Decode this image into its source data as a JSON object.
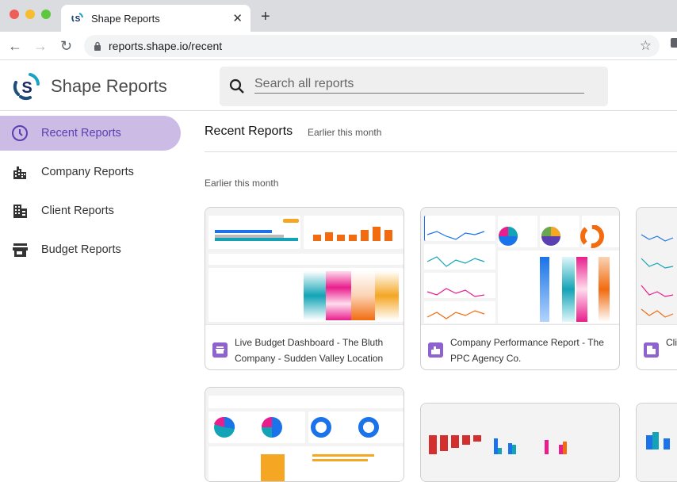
{
  "browser": {
    "tab_title": "Shape Reports",
    "tab_close": "✕",
    "new_tab": "+",
    "url": "reports.shape.io/recent",
    "back": "←",
    "forward": "→",
    "reload": "↻",
    "bookmark": "☆"
  },
  "app": {
    "brand": "Shape Reports",
    "search_placeholder": "Search all reports",
    "colors": {
      "accent": "#cbbbe5",
      "accent_text": "#5b3fb0",
      "card_icon": "#8e63cf"
    }
  },
  "sidebar": {
    "items": [
      {
        "label": "Recent Reports",
        "icon": "clock-icon",
        "active": true
      },
      {
        "label": "Company Reports",
        "icon": "buildings-icon",
        "active": false
      },
      {
        "label": "Client Reports",
        "icon": "office-icon",
        "active": false
      },
      {
        "label": "Budget Reports",
        "icon": "store-icon",
        "active": false
      }
    ]
  },
  "main": {
    "title": "Recent Reports",
    "subtitle": "Earlier this month",
    "section_label": "Earlier this month",
    "cards": [
      {
        "title": "Live Budget Dashboard - The Bluth Company - Sudden Valley Location",
        "icon": "store-icon"
      },
      {
        "title": "Company Performance Report - The PPC Agency Co.",
        "icon": "buildings-icon"
      },
      {
        "title": "Client Reports Co",
        "icon": "office-icon"
      }
    ]
  }
}
